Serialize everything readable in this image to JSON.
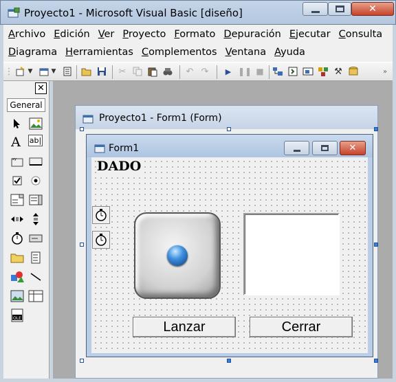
{
  "window": {
    "title": "Proyecto1 - Microsoft Visual Basic [diseño]"
  },
  "menu": {
    "row1": [
      "Archivo",
      "Edición",
      "Ver",
      "Proyecto",
      "Formato",
      "Depuración",
      "Ejecutar",
      "Consulta"
    ],
    "row2": [
      "Diagrama",
      "Herramientas",
      "Complementos",
      "Ventana",
      "Ayuda"
    ]
  },
  "toolbox": {
    "close_label": "✕",
    "tab_label": "General",
    "label_tool": "A",
    "textbox_tool": "ab|"
  },
  "designer": {
    "title": "Proyecto1 - Form1 (Form)"
  },
  "form": {
    "title": "Form1",
    "label_text": "DADO",
    "lanzar_label": "Lanzar",
    "cerrar_label": "Cerrar"
  }
}
